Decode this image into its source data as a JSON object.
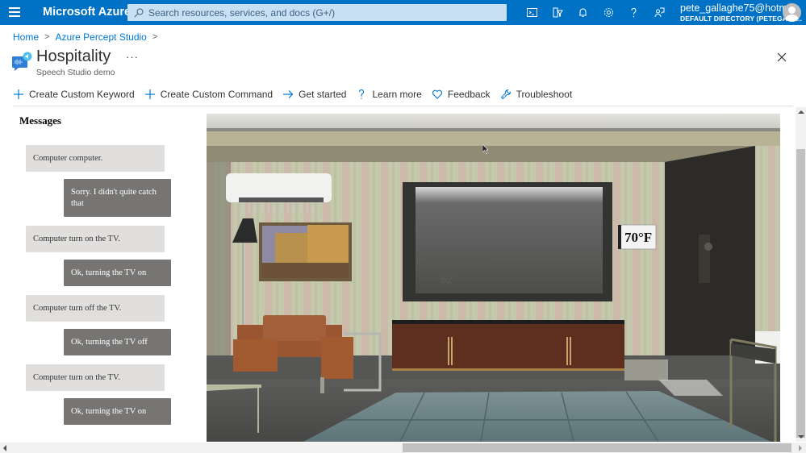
{
  "topbar": {
    "brand": "Microsoft Azure",
    "search_placeholder": "Search resources, services, and docs (G+/)",
    "icons": [
      "cloud-shell-icon",
      "directory-filter-icon",
      "notifications-icon",
      "settings-icon",
      "help-icon",
      "feedback-icon"
    ],
    "account_email": "pete_gallaghe75@hotm...",
    "account_directory": "DEFAULT DIRECTORY (PETEGALL..."
  },
  "breadcrumb": {
    "items": [
      "Home",
      "Azure Percept Studio"
    ]
  },
  "header": {
    "title": "Hospitality",
    "subtitle": "Speech Studio demo",
    "more_label": "···"
  },
  "commands": [
    {
      "label": "Create Custom Keyword",
      "icon": "plus-icon"
    },
    {
      "label": "Create Custom Command",
      "icon": "plus-icon"
    },
    {
      "label": "Get started",
      "icon": "arrow-right-icon"
    },
    {
      "label": "Learn more",
      "icon": "question-icon"
    },
    {
      "label": "Feedback",
      "icon": "heart-icon"
    },
    {
      "label": "Troubleshoot",
      "icon": "wrench-icon"
    }
  ],
  "messages": {
    "title": "Messages",
    "items": [
      {
        "role": "user",
        "text": "Computer computer."
      },
      {
        "role": "bot",
        "text": "Sorry. I didn't quite catch that"
      },
      {
        "role": "user",
        "text": "Computer turn on the TV."
      },
      {
        "role": "bot",
        "text": "Ok, turning the TV on"
      },
      {
        "role": "user",
        "text": "Computer turn off the TV."
      },
      {
        "role": "bot",
        "text": "Ok, turning the TV off"
      },
      {
        "role": "user",
        "text": "Computer turn on the TV."
      },
      {
        "role": "bot",
        "text": "Ok, turning the TV on"
      }
    ]
  },
  "scene": {
    "thermostat": "70°F",
    "tv_date": "Monday, May 18th",
    "tv_temp": "62°"
  },
  "colors": {
    "azure_blue": "#0072c6",
    "link_blue": "#0078d4",
    "user_bubble": "#e0dfde",
    "bot_bubble": "#767574"
  }
}
